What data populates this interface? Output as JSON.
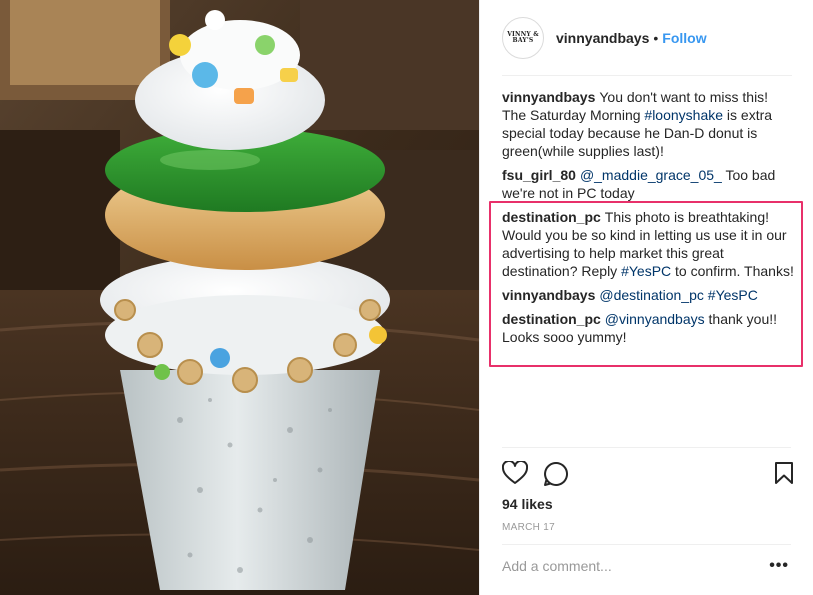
{
  "post": {
    "username": "vinnyandbays",
    "avatar_text": "VINNY & BAY'S",
    "dot": "•",
    "follow_label": "Follow",
    "photo_icon": "milkshake-photo"
  },
  "comments": [
    {
      "user": "vinnyandbays",
      "parts": [
        {
          "t": "text",
          "v": "You don't want to miss this! The Saturday Morning "
        },
        {
          "t": "link",
          "v": "#loonyshake"
        },
        {
          "t": "text",
          "v": " is extra special today because he Dan-D donut is green(while supplies last)!"
        }
      ]
    },
    {
      "user": "fsu_girl_80",
      "parts": [
        {
          "t": "link",
          "v": "@_maddie_grace_05_"
        },
        {
          "t": "text",
          "v": " Too bad we're not in PC today"
        }
      ]
    },
    {
      "user": "destination_pc",
      "parts": [
        {
          "t": "text",
          "v": "This photo is breathtaking! Would you be so kind in letting us use it in our advertising to help market this great destination? Reply "
        },
        {
          "t": "link",
          "v": "#YesPC"
        },
        {
          "t": "text",
          "v": " to confirm. Thanks!"
        }
      ]
    },
    {
      "user": "vinnyandbays",
      "parts": [
        {
          "t": "link",
          "v": "@destination_pc"
        },
        {
          "t": "text",
          "v": " "
        },
        {
          "t": "link",
          "v": "#YesPC"
        }
      ]
    },
    {
      "user": "destination_pc",
      "parts": [
        {
          "t": "link",
          "v": "@vinnyandbays"
        },
        {
          "t": "text",
          "v": " thank you!! Looks sooo yummy!"
        }
      ]
    }
  ],
  "actions": {
    "like_icon": "heart-icon",
    "comment_icon": "comment-bubble-icon",
    "save_icon": "bookmark-icon"
  },
  "likes_label": "94 likes",
  "date_label": "MARCH 17",
  "add_comment": {
    "placeholder": "Add a comment...",
    "value": ""
  },
  "more_label": "•••",
  "colors": {
    "link": "#003569",
    "follow": "#3897f0",
    "highlight_border": "#e8306a",
    "muted": "#999999"
  }
}
